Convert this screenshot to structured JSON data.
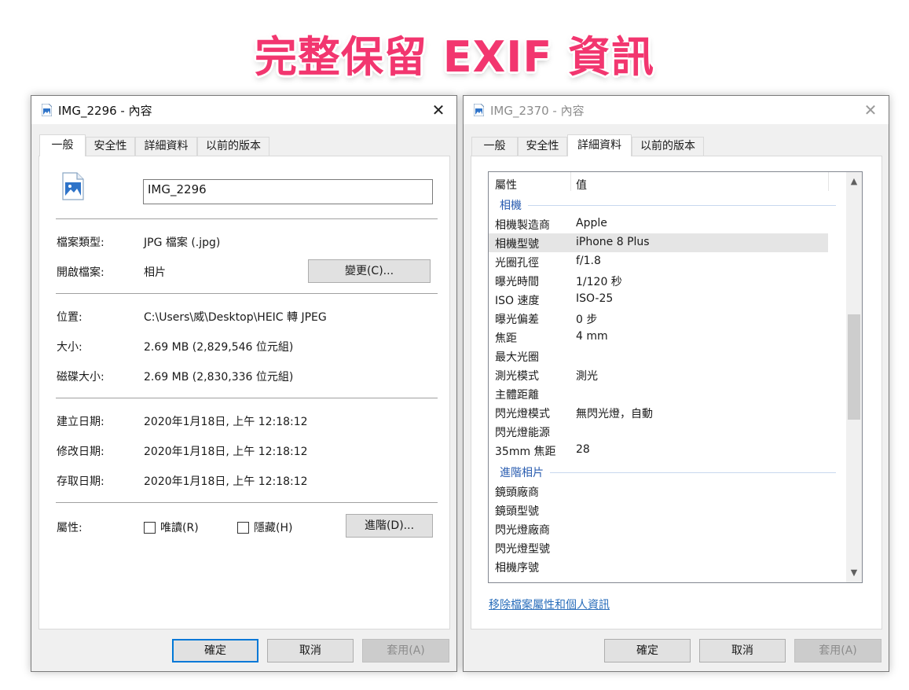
{
  "headline": "完整保留 EXIF 資訊",
  "left_dialog": {
    "title": "IMG_2296 - 內容",
    "tabs": [
      "一般",
      "安全性",
      "詳細資料",
      "以前的版本"
    ],
    "file_name": "IMG_2296",
    "fields": {
      "type_label": "檔案類型:",
      "type_value": "JPG 檔案 (.jpg)",
      "open_label": "開啟檔案:",
      "open_value": "相片",
      "change_button": "變更(C)...",
      "location_label": "位置:",
      "location_value": "C:\\Users\\威\\Desktop\\HEIC 轉 JPEG",
      "size_label": "大小:",
      "size_value": "2.69 MB (2,829,546 位元組)",
      "disk_size_label": "磁碟大小:",
      "disk_size_value": "2.69 MB (2,830,336 位元組)",
      "created_label": "建立日期:",
      "created_value": "2020年1月18日, 上午 12:18:12",
      "modified_label": "修改日期:",
      "modified_value": "2020年1月18日, 上午 12:18:12",
      "accessed_label": "存取日期:",
      "accessed_value": "2020年1月18日, 上午 12:18:12",
      "attributes_label": "屬性:",
      "readonly_label": "唯讀(R)",
      "hidden_label": "隱藏(H)",
      "advanced_button": "進階(D)..."
    },
    "buttons": {
      "ok": "確定",
      "cancel": "取消",
      "apply": "套用(A)"
    }
  },
  "right_dialog": {
    "title": "IMG_2370 - 內容",
    "tabs": [
      "一般",
      "安全性",
      "詳細資料",
      "以前的版本"
    ],
    "header": {
      "property": "屬性",
      "value": "值"
    },
    "group_camera": "相機",
    "camera_rows": [
      {
        "name": "相機製造商",
        "value": "Apple"
      },
      {
        "name": "相機型號",
        "value": "iPhone 8 Plus"
      },
      {
        "name": "光圈孔徑",
        "value": "f/1.8"
      },
      {
        "name": "曝光時間",
        "value": "1/120 秒"
      },
      {
        "name": "ISO 速度",
        "value": "ISO-25"
      },
      {
        "name": "曝光偏差",
        "value": "0 步"
      },
      {
        "name": "焦距",
        "value": "4 mm"
      },
      {
        "name": "最大光圈",
        "value": ""
      },
      {
        "name": "測光模式",
        "value": "測光"
      },
      {
        "name": "主體距離",
        "value": ""
      },
      {
        "name": "閃光燈模式",
        "value": "無閃光燈，自動"
      },
      {
        "name": "閃光燈能源",
        "value": ""
      },
      {
        "name": "35mm 焦距",
        "value": "28"
      }
    ],
    "group_advanced": "進階相片",
    "advanced_rows": [
      {
        "name": "鏡頭廠商",
        "value": ""
      },
      {
        "name": "鏡頭型號",
        "value": ""
      },
      {
        "name": "閃光燈廠商",
        "value": ""
      },
      {
        "name": "閃光燈型號",
        "value": ""
      },
      {
        "name": "相機序號",
        "value": ""
      }
    ],
    "remove_link": "移除檔案屬性和個人資訊",
    "buttons": {
      "ok": "確定",
      "cancel": "取消",
      "apply": "套用(A)"
    }
  },
  "icons": {
    "close": "close-icon",
    "file": "image-file-icon",
    "scroll_up": "scroll-up-icon",
    "scroll_down": "scroll-down-icon"
  },
  "colors": {
    "headline": "#f2366f",
    "accent": "#0078d7",
    "link": "#2a6ebb",
    "group": "#2a5db0"
  }
}
